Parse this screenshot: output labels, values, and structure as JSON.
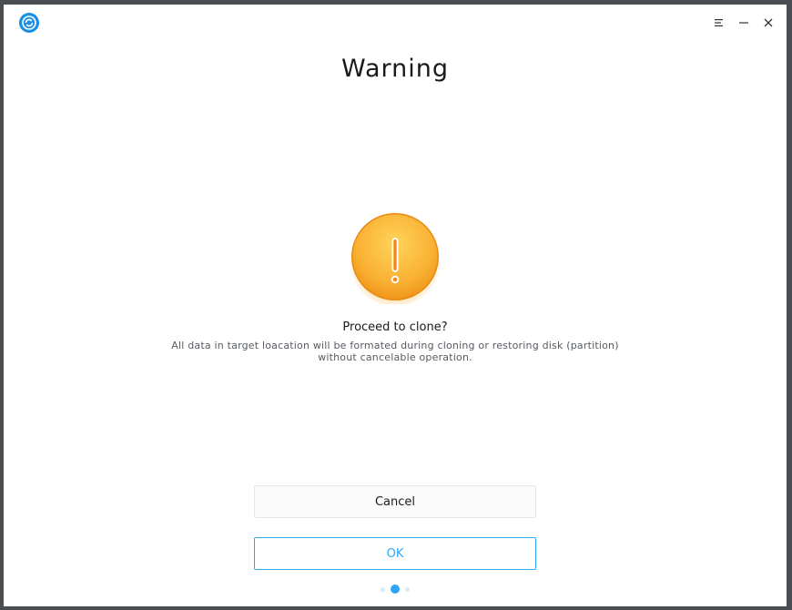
{
  "window": {
    "title": "Warning"
  },
  "titlebar": {
    "app_icon": "clone-app-icon",
    "menu_icon": "hamburger-menu-icon",
    "minimize_icon": "minimize-icon",
    "close_icon": "close-icon"
  },
  "dialog": {
    "icon": "warning-exclamation-icon",
    "question": "Proceed to clone?",
    "description": "All data in target loacation will be formated during cloning or restoring disk (partition) without cancelable operation."
  },
  "buttons": {
    "cancel_label": "Cancel",
    "ok_label": "OK"
  },
  "pager": {
    "total": 3,
    "current": 2
  },
  "colors": {
    "accent": "#2ca7f8",
    "warning_orange": "#f5a623",
    "text_primary": "#1a1a1a",
    "text_secondary": "#555a60"
  }
}
